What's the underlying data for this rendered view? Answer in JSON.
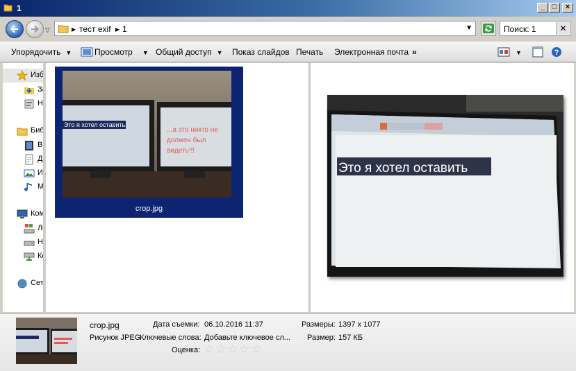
{
  "window": {
    "title": "1"
  },
  "address": {
    "crumbs": [
      "тест exif",
      "1"
    ],
    "search_value": "Поиск: 1"
  },
  "toolbar": {
    "organize": "Упорядочить",
    "view": "Просмотр",
    "share": "Общий доступ",
    "slideshow": "Показ слайдов",
    "print": "Печать",
    "email": "Электронная почта",
    "more": "»"
  },
  "nav": {
    "favorites": "Избранное",
    "downloads": "Загрузки",
    "recent": "Недавние места",
    "libraries": "Библиотеки",
    "video": "Видео",
    "documents": "Документы",
    "images": "Изображения",
    "music": "Музыка",
    "computer": "Компьютер",
    "local_disk": "Локальный диск",
    "drive2": "Новый том",
    "drive3": "Компакт-диск",
    "network": "Сеть"
  },
  "file": {
    "name": "crop.jpg",
    "img_text_left": "Это я хотел оставить",
    "img_text_right": [
      "...а это никто не",
      "должен был",
      "видеть!!!"
    ]
  },
  "details": {
    "filename": "crop.jpg",
    "date_label": "Дата съемки:",
    "date_value": "06.10.2016 11:37",
    "dims_label": "Размеры:",
    "dims_value": "1397 x 1077",
    "type": "Рисунок JPEG",
    "keywords_label": "Ключевые слова:",
    "keywords_value": "Добавьте ключевое сл...",
    "size_label": "Размер:",
    "size_value": "157 КБ",
    "rating_label": "Оценка:",
    "rating_value": 0
  },
  "colors": {
    "selection": "#0d2472",
    "window_bg": "#d4d0c8"
  }
}
